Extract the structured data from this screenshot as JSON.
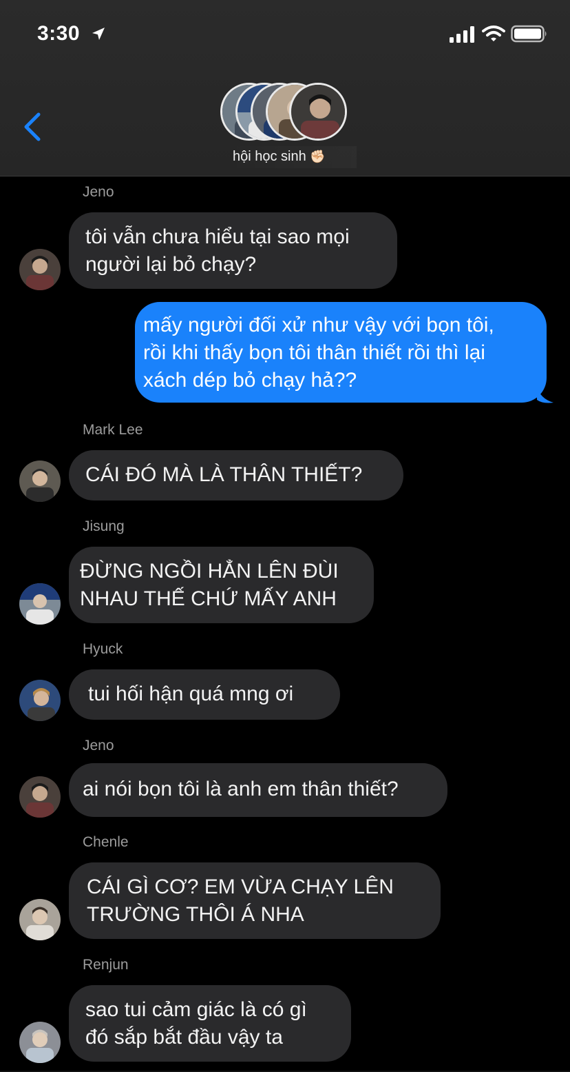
{
  "status_bar": {
    "time": "3:30",
    "icons": [
      "location-arrow-icon",
      "cellular-signal-icon",
      "wifi-icon",
      "battery-icon"
    ]
  },
  "header": {
    "back_icon": "chevron-left-icon",
    "group_name": "hội học sinh",
    "group_emoji": "✊🏻",
    "member_avatar_count": 5
  },
  "messages": [
    {
      "sender": "Jeno",
      "type": "incoming",
      "lines": [
        "tôi vẫn chưa hiểu tại sao mọi",
        "người lại bỏ chạy?"
      ]
    },
    {
      "sender": "",
      "type": "outgoing",
      "lines": [
        "mấy người đối xử như vậy với bọn tôi,",
        "rồi khi thấy bọn tôi thân thiết rồi thì lại",
        "xách dép bỏ chạy hả??"
      ]
    },
    {
      "sender": "Mark Lee",
      "type": "incoming",
      "lines": [
        "CÁI ĐÓ MÀ LÀ THÂN THIẾT?"
      ]
    },
    {
      "sender": "Jisung",
      "type": "incoming",
      "lines": [
        "ĐỪNG NGỒI HẲN LÊN ĐÙI",
        "NHAU THẾ CHỨ MẤY ANH"
      ]
    },
    {
      "sender": "Hyuck",
      "type": "incoming",
      "lines": [
        "tui hối hận quá mng ơi"
      ]
    },
    {
      "sender": "Jeno",
      "type": "incoming",
      "lines": [
        "ai nói bọn tôi là anh em thân thiết?"
      ]
    },
    {
      "sender": "Chenle",
      "type": "incoming",
      "lines": [
        "CÁI GÌ CƠ? EM VỪA CHẠY LÊN",
        "TRƯỜNG THÔI Á NHA"
      ]
    },
    {
      "sender": "Renjun",
      "type": "incoming",
      "lines": [
        "sao tui cảm giác là có gì",
        "đó sắp bắt đầu vậy ta"
      ]
    }
  ],
  "colors": {
    "accent_blue": "#1a82fb",
    "incoming_bubble": "#2a2a2c",
    "background": "#000000",
    "header_bg": "#2b2b2b",
    "sender_text": "#9c9c9c"
  }
}
